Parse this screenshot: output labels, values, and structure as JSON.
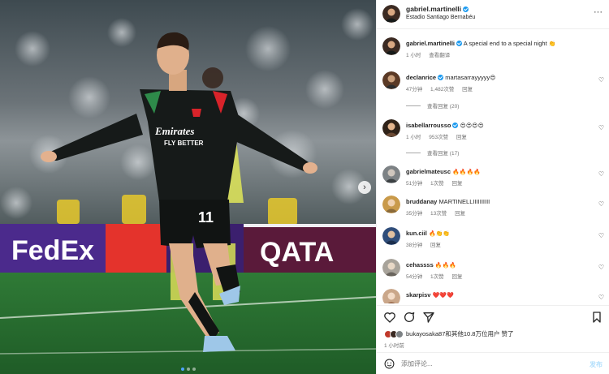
{
  "media": {
    "kit": {
      "sponsor_line1": "Emirates",
      "sponsor_line2": "FLY BETTER",
      "number": "11"
    },
    "board_left": "FedEx",
    "board_right": "QATA",
    "carousel": {
      "count": 3,
      "active": 0
    }
  },
  "header": {
    "username": "gabriel.martinelli",
    "location": "Estadio Santiago Bernabéu",
    "more_label": "···"
  },
  "caption": {
    "username": "gabriel.martinelli",
    "text": "A special end to a special night",
    "emoji": "👏",
    "time": "1 小时",
    "translate": "查看翻译"
  },
  "comments": [
    {
      "username": "declanrice",
      "verified": true,
      "text": "martasarrayyyyy",
      "emoji": "😍",
      "time": "47分钟",
      "likes": "1,482次赞",
      "reply": "回复",
      "replies": "查看回复 (20)"
    },
    {
      "username": "isabellarrousso",
      "verified": true,
      "text": "",
      "emoji": "😍😍😍😍",
      "time": "1 小时",
      "likes": "953次赞",
      "reply": "回复",
      "replies": "查看回复 (17)"
    },
    {
      "username": "gabrielmateusc",
      "verified": false,
      "text": "",
      "emoji": "🔥🔥🔥🔥",
      "time": "51分钟",
      "likes": "1次赞",
      "reply": "回复"
    },
    {
      "username": "bruddanay",
      "verified": false,
      "text": "MARTINELLIIIIIIIIII",
      "emoji": "",
      "time": "35分钟",
      "likes": "13次赞",
      "reply": "回复"
    },
    {
      "username": "kun.ciil",
      "verified": false,
      "text": "",
      "emoji": "🔥👏👏",
      "time": "38分钟",
      "likes": "",
      "reply": "回复"
    },
    {
      "username": "cehassss",
      "verified": false,
      "text": "",
      "emoji": "🔥🔥🔥",
      "time": "54分钟",
      "likes": "1次赞",
      "reply": "回复"
    },
    {
      "username": "skarpisv",
      "verified": false,
      "text": "",
      "emoji": "❤️❤️❤️",
      "time": "",
      "likes": "",
      "reply": ""
    }
  ],
  "likes_line": "bukayosaka87和其他10.8万位用户 赞了",
  "post_time": "1 小时前",
  "add_comment": {
    "placeholder": "添加评论...",
    "post_label": "发布"
  },
  "colors": {
    "kit": "#161a19",
    "accent_red": "#d8232a",
    "verified": "#1d9bf0",
    "post_btn_disabled": "#b2dffc"
  }
}
